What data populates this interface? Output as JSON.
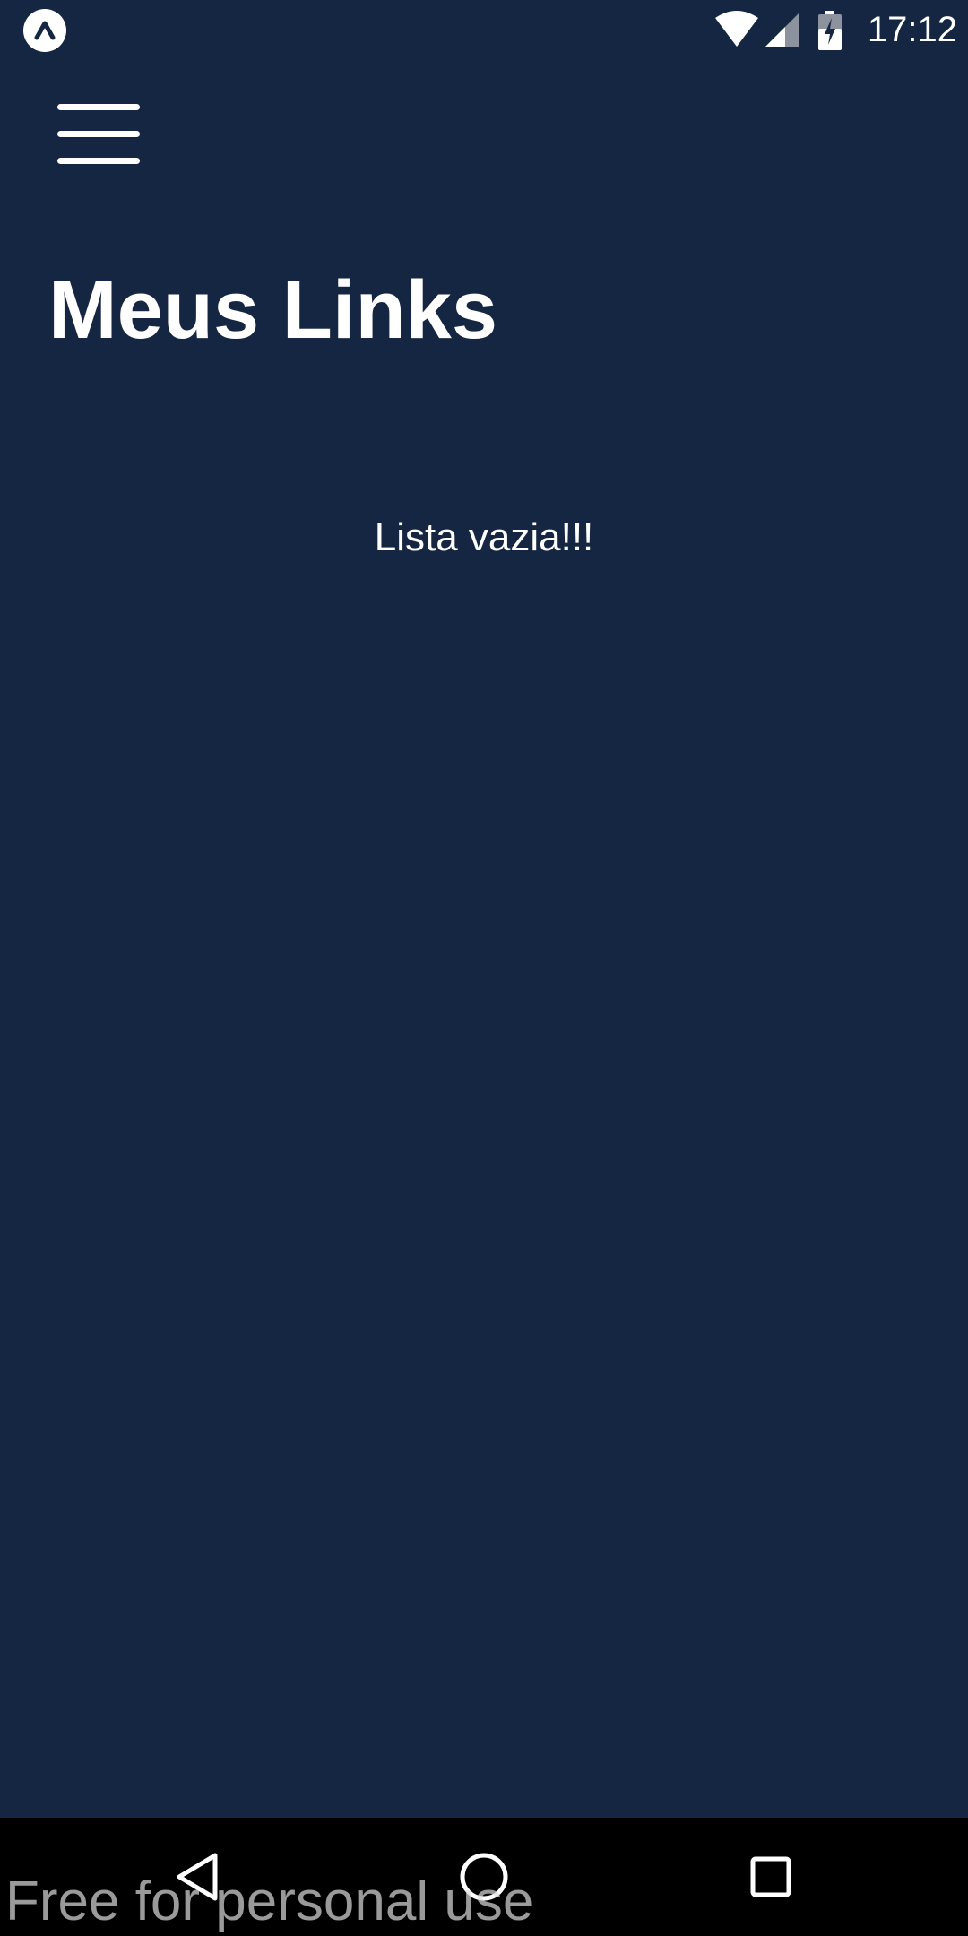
{
  "status_bar": {
    "time": "17:12",
    "icons": [
      "expo-icon",
      "wifi-icon",
      "signal-icon",
      "battery-charging-icon"
    ]
  },
  "header": {
    "menu_icon": "hamburger-menu-icon",
    "title": "Meus Links"
  },
  "main": {
    "empty_text": "Lista vazia!!!"
  },
  "nav_bar": {
    "buttons": [
      "back-icon",
      "home-icon",
      "recents-icon"
    ]
  },
  "watermark": "Free for personal use",
  "colors": {
    "background": "#152642",
    "text": "#ffffff",
    "nav_bar": "#000000"
  }
}
